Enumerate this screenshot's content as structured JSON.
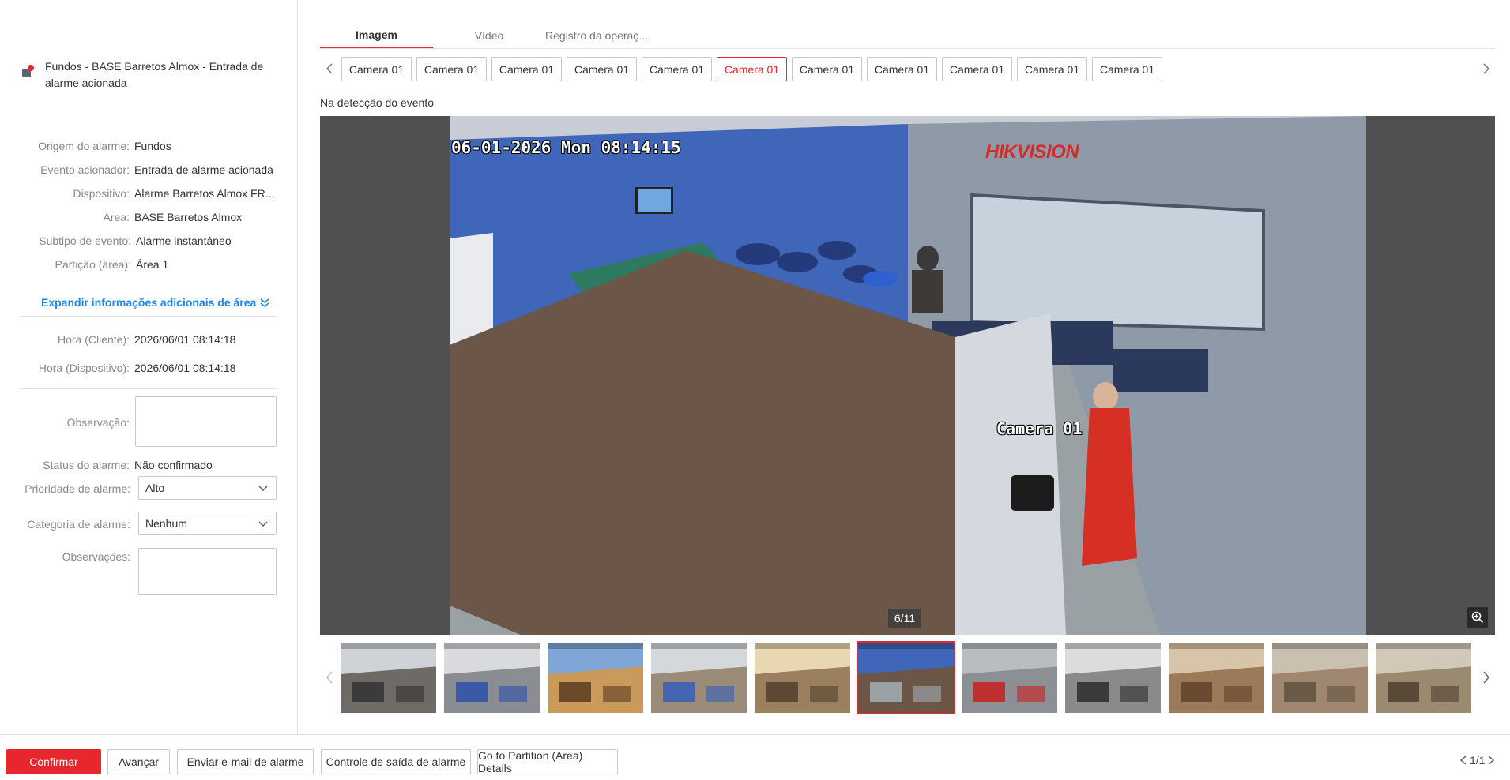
{
  "left": {
    "title": "Fundos - BASE Barretos Almox - Entrada de alarme acionada",
    "fields": {
      "origem_label": "Origem do alarme:",
      "origem_value": "Fundos",
      "evento_label": "Evento acionador:",
      "evento_value": "Entrada de alarme acionada",
      "dispositivo_label": "Dispositivo:",
      "dispositivo_value": "Alarme Barretos Almox FR...",
      "area_label": "Área:",
      "area_value": "BASE Barretos Almox",
      "subtipo_label": "Subtipo de evento:",
      "subtipo_value": "Alarme instantâneo",
      "particao_label": "Partição (área):",
      "particao_value": "Área 1"
    },
    "expand_label": "Expandir informações adicionais de área",
    "hora_cliente_label": "Hora (Cliente):",
    "hora_cliente_value": "2026/06/01 08:14:18",
    "hora_dispositivo_label": "Hora (Dispositivo):",
    "hora_dispositivo_value": "2026/06/01 08:14:18",
    "observacao_label": "Observação:",
    "status_label": "Status do alarme:",
    "status_value": "Não confirmado",
    "prioridade_label": "Prioridade de alarme:",
    "prioridade_value": "Alto",
    "categoria_label": "Categoria de alarme:",
    "categoria_value": "Nenhum",
    "observacoes_label": "Observações:"
  },
  "tabs": [
    "Imagem",
    "Vídeo",
    "Registro da operaç..."
  ],
  "cameras": [
    "Camera 01",
    "Camera 01",
    "Camera 01",
    "Camera 01",
    "Camera 01",
    "Camera 01",
    "Camera 01",
    "Camera 01",
    "Camera 01",
    "Camera 01",
    "Camera 01"
  ],
  "active_camera_index": 5,
  "note": "Na detecção do evento",
  "viewer": {
    "osd_timestamp": "06-01-2026 Mon 08:14:15",
    "osd_camera": "Camera 01",
    "brand": "HIKVISION",
    "counter": "6/11"
  },
  "thumbnails_count": 11,
  "active_thumbnail_index": 5,
  "buttons": {
    "confirmar": "Confirmar",
    "avancar": "Avançar",
    "email": "Enviar e-mail de alarme",
    "saida": "Controle de saída de alarme",
    "partition": "Go to Partition (Area) Details"
  },
  "pager": "1/1",
  "colors": {
    "accent": "#e8262d",
    "link": "#1d87e6"
  }
}
